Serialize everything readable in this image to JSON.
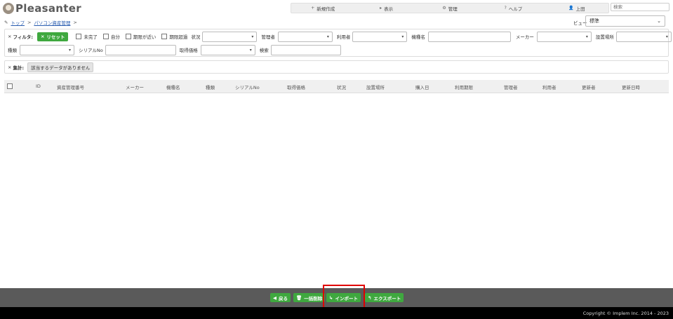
{
  "app": {
    "brand": "Pleasanter"
  },
  "topnav": {
    "new": {
      "icon": "+",
      "label": "新規作成"
    },
    "view": {
      "icon": "▸",
      "label": "表示"
    },
    "manage": {
      "icon": "⚙",
      "label": "管理"
    },
    "help": {
      "icon": "?",
      "label": "ヘルプ"
    },
    "user": {
      "icon": "👤",
      "label": "上田"
    },
    "search_placeholder": "検索"
  },
  "breadcrumb": {
    "icon": "✎",
    "top": "トップ",
    "sep": ">",
    "current": "パソコン資産管理",
    "sep2": ">"
  },
  "view_selector": {
    "label": "ビュー",
    "value": "標準",
    "arrow": "⌄"
  },
  "filter": {
    "title": "フィルタ:",
    "reset_label": "リセット",
    "checkboxes": [
      "未完了",
      "自分",
      "期限が近い",
      "期限超過"
    ],
    "fields": {
      "status": "状況",
      "manager": "管理者",
      "user": "利用者",
      "model_name": "機種名",
      "maker": "メーカー",
      "location": "設置場所",
      "type": "種類",
      "serial": "シリアルNo",
      "price": "取得価格",
      "search": "検索"
    },
    "arrow": "▾"
  },
  "summary": {
    "title": "集計:",
    "no_data": "該当するデータがありません"
  },
  "table": {
    "columns": [
      "ID",
      "資産管理番号",
      "メーカー",
      "機種名",
      "種類",
      "シリアルNo",
      "取得価格",
      "状況",
      "設置場所",
      "購入日",
      "利用期限",
      "管理者",
      "利用者",
      "更新者",
      "更新日時"
    ]
  },
  "footer": {
    "back": {
      "icon": "◀",
      "label": "戻る"
    },
    "bulk_delete": {
      "icon": "🗑",
      "label": "一括削除"
    },
    "import": {
      "icon": "↳",
      "label": "インポート"
    },
    "export": {
      "icon": "↰",
      "label": "エクスポート"
    },
    "copyright": "Copyright © Implem Inc. 2014 - 2023"
  }
}
